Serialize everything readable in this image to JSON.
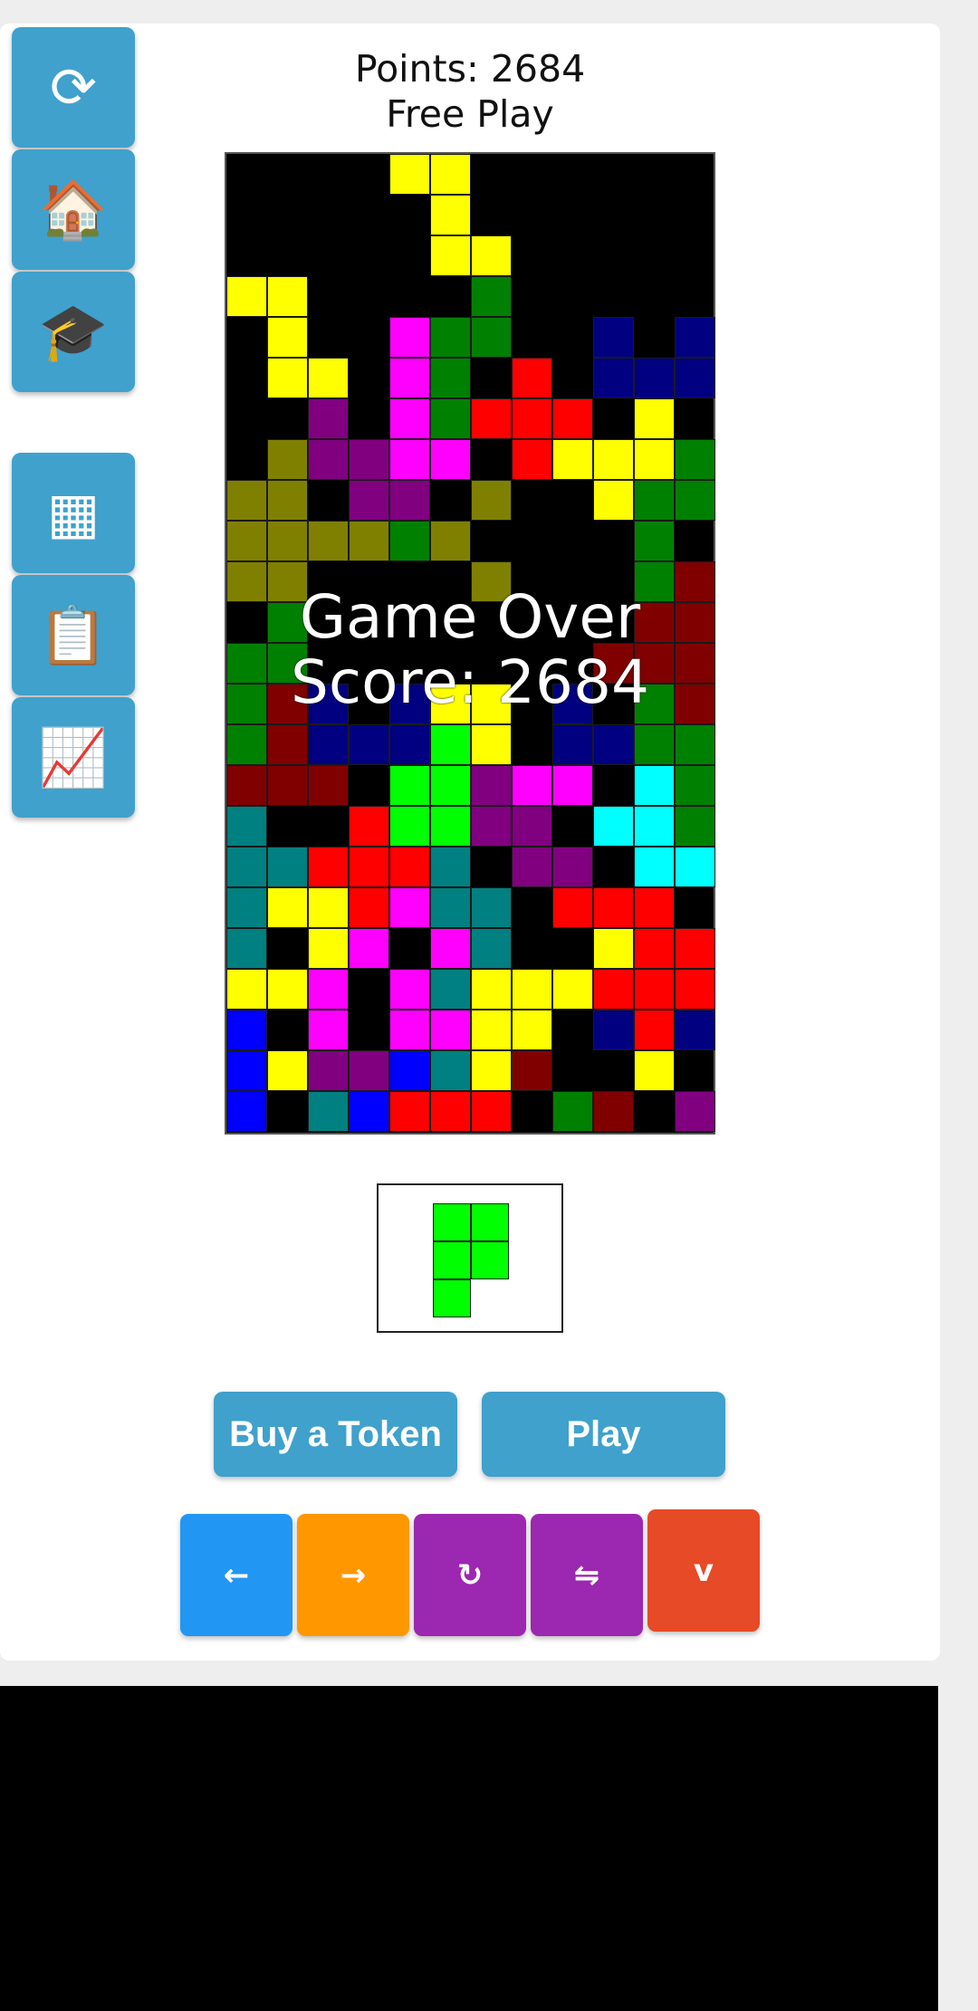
{
  "header": {
    "points": "Points: 2684",
    "mode": "Free Play"
  },
  "overlay": {
    "line1": "Game Over",
    "line2": "Score: 2684"
  },
  "sidebar": [
    {
      "name": "restart-icon",
      "glyph": "⟳"
    },
    {
      "name": "home-icon",
      "glyph": "🏠"
    },
    {
      "name": "graduation-cap-icon",
      "glyph": "🎓"
    },
    {
      "name": "grid-icon",
      "glyph": "▦"
    },
    {
      "name": "clipboard-icon",
      "glyph": "📋"
    },
    {
      "name": "chart-icon",
      "glyph": "📈"
    }
  ],
  "buttons": {
    "buy_token": "Buy a Token",
    "play": "Play"
  },
  "controls": [
    {
      "name": "move-left-button",
      "glyph": "←",
      "color": "#2196f3"
    },
    {
      "name": "move-right-button",
      "glyph": "→",
      "color": "#ff9800"
    },
    {
      "name": "rotate-button",
      "glyph": "↻",
      "color": "#9c27b0"
    },
    {
      "name": "flip-button",
      "glyph": "⇋",
      "color": "#9c27b0"
    },
    {
      "name": "drop-button",
      "glyph": "v",
      "color": "#e64a27"
    }
  ],
  "colors": {
    "Y": "#ffff00",
    "G": "#008000",
    "L": "#00ff00",
    "M": "#ff00ff",
    "P": "#800080",
    "O": "#808000",
    "R": "#ff0000",
    "D": "#800000",
    "N": "#000080",
    "B": "#0000ff",
    "T": "#008080",
    "C": "#00ffff"
  },
  "board": {
    "cols": 12,
    "rows": [
      "....YY......",
      ".....Y......",
      ".....YY.....",
      "YY....G.....",
      ".Y..MGG..N.N",
      ".YY.MG.R.NNN",
      "..P.MGRRR.Y.",
      ".OPPMM.RYYYG",
      "OO.PP.O..YGG",
      "OOOOGO....G.",
      "OO....O...GD",
      ".G........DD",
      "GG.......DDD",
      "GDN.NYY.N.GD",
      "GDNNNLY.NNGG",
      "DDD.LLPMM.CG",
      "T..RLLPP.CCG",
      "TTRRRT.PP.CC",
      "TYYRMTT.RRR.",
      "T.YM.MT..YRR.",
      "YYM.MTYYYRRR",
      "B.M.MMYY.NRN",
      "BYPPBTYD..Y.",
      "B.TBRRR.GD.P"
    ]
  },
  "next_piece": {
    "color": "#00ff00",
    "cells": [
      [
        0,
        0
      ],
      [
        1,
        0
      ],
      [
        0,
        1
      ],
      [
        1,
        1
      ],
      [
        0,
        2
      ]
    ]
  }
}
